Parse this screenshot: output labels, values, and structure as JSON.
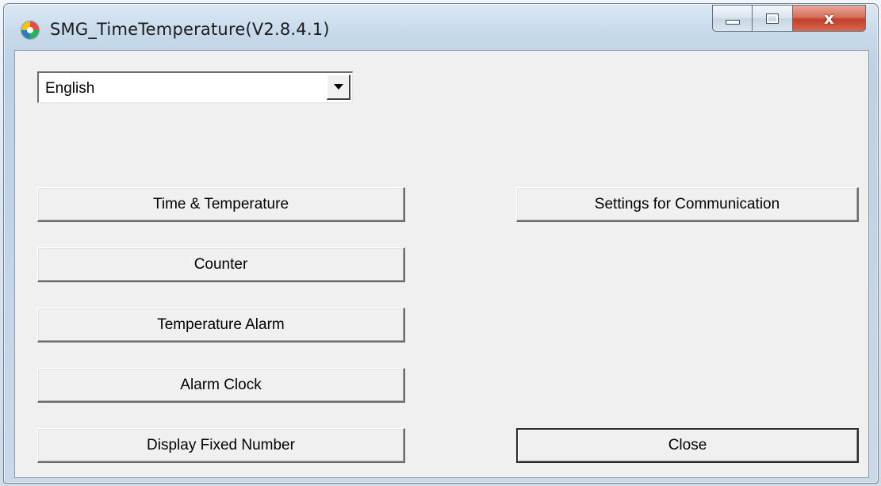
{
  "window": {
    "title": "SMG_TimeTemperature(V2.8.4.1)",
    "icon": "app-color-wheel-icon",
    "controls": {
      "minimize_icon": "minimize-icon",
      "maximize_icon": "maximize-icon",
      "close_glyph": "x"
    }
  },
  "language_select": {
    "value": "English",
    "dropdown_icon": "chevron-down-icon"
  },
  "buttons": {
    "time_temperature": "Time & Temperature",
    "counter": "Counter",
    "temperature_alarm": "Temperature Alarm",
    "alarm_clock": "Alarm Clock",
    "display_fixed_number": "Display Fixed Number",
    "settings_communication": "Settings for Communication",
    "close": "Close"
  },
  "colors": {
    "dialog_bg": "#f0f0f0",
    "close_button_red": "#c0402a",
    "frame_blue": "#c6d9ea"
  }
}
